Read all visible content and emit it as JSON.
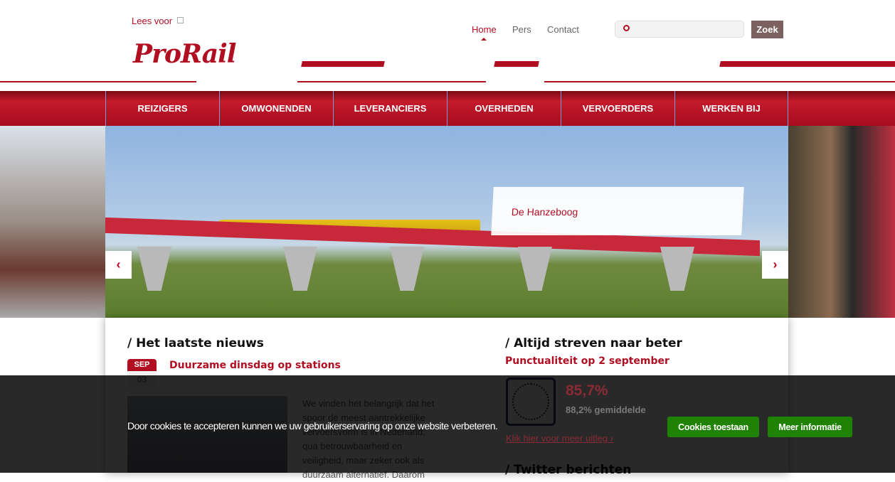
{
  "header": {
    "lees_voor": "Lees voor",
    "logo": "ProRail",
    "top_nav": [
      "Home",
      "Pers",
      "Contact"
    ],
    "search_placeholder": "",
    "search_button": "Zoek"
  },
  "nav": [
    "REIZIGERS",
    "OMWONENDEN",
    "LEVERANCIERS",
    "OVERHEDEN",
    "VERVOERDERS",
    "WERKEN BIJ"
  ],
  "hero": {
    "caption": "De Hanzeboog",
    "prev": "‹",
    "next": "›"
  },
  "news": {
    "title": "/  Het laatste nieuws",
    "month": "SEP",
    "day": "03",
    "headline": "Duurzame dinsdag op stations",
    "body": "We vinden het belangrijk dat het spoor de meest aantrekkelijke vervoersvorm is in Nederland; qua betrouwbaarheid en veiligheid, maar zeker ook als duurzaam alternatief. Daarom"
  },
  "punctuality": {
    "title": "/  Altijd streven naar beter",
    "subtitle": "Punctualiteit op 2 september",
    "value": "85,7%",
    "average": "88,2% gemiddelde",
    "link": "Klik hier voor meer uitleg ›",
    "twitter_title": "/  Twitter berichten"
  },
  "cookie": {
    "text": "Door cookies te accepteren kunnen we uw gebruikerservaring op onze website verbeteren.",
    "accept": "Cookies toestaan",
    "more": "Meer informatie"
  }
}
